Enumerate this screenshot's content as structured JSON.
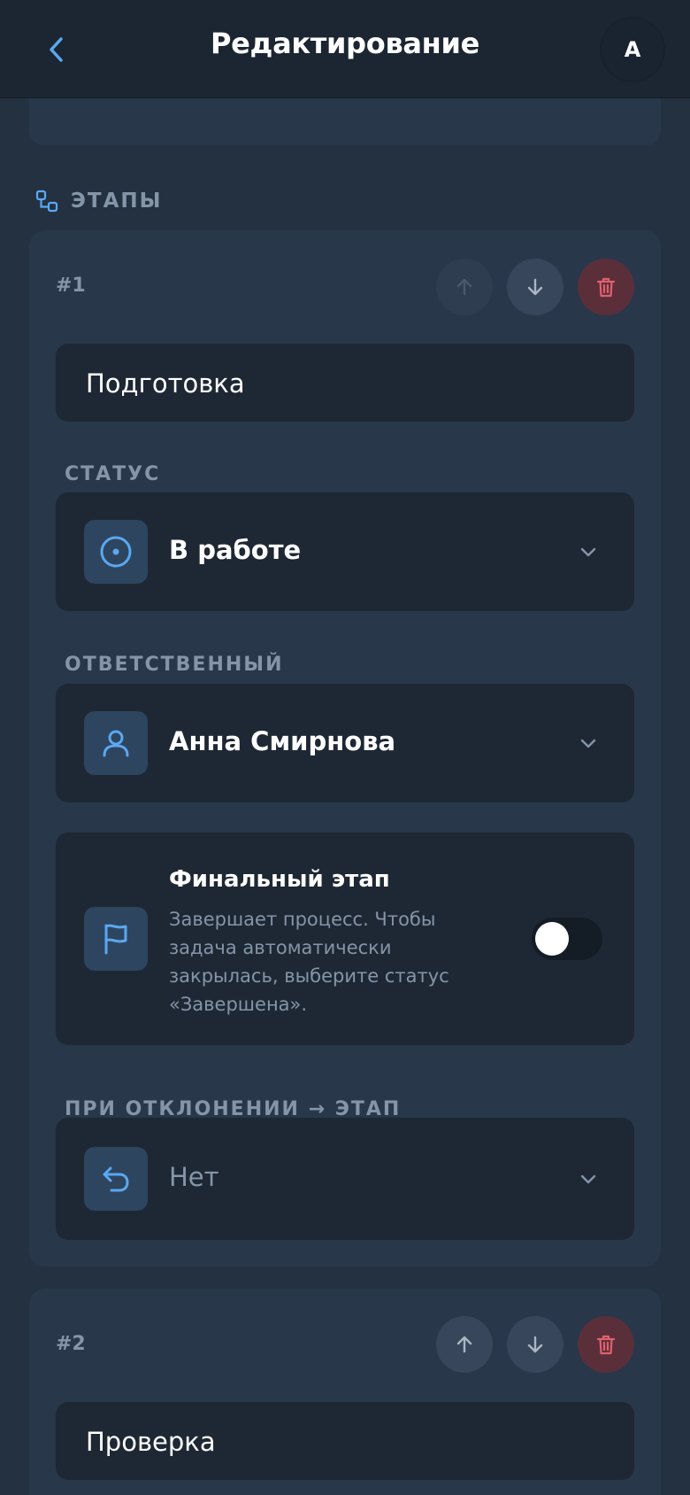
{
  "header": {
    "title": "Редактирование",
    "avatar_initial": "А"
  },
  "stages_section": {
    "label": "ЭТАПЫ"
  },
  "stages": [
    {
      "number": "#1",
      "name": "Подготовка",
      "status_label": "СТАТУС",
      "status_value": "В работе",
      "assignee_label": "ОТВЕТСТВЕННЫЙ",
      "assignee_value": "Анна Смирнова",
      "final_title": "Финальный этап",
      "final_description": "Завершает процесс. Чтобы задача автоматически закрылась, выберите статус «Завершена».",
      "final_enabled": false,
      "reject_label": "ПРИ ОТКЛОНЕНИИ → ЭТАП",
      "reject_value": "Нет"
    },
    {
      "number": "#2",
      "name": "Проверка"
    }
  ],
  "colors": {
    "accent": "#5aa8f0",
    "danger": "#e0606e",
    "background": "#243141",
    "card": "#29374a",
    "field": "#1e2834"
  }
}
